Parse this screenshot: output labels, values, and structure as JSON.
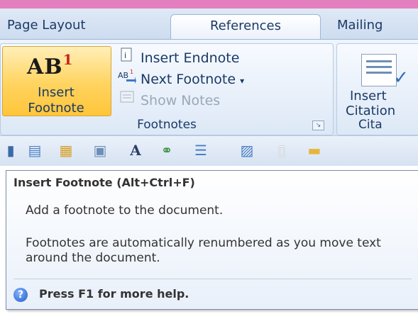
{
  "tabs": {
    "page_layout": "Page Layout",
    "references": "References",
    "mailings": "Mailing"
  },
  "footnotes_group": {
    "insert_footnote_icon": "AB",
    "insert_footnote_sup": "1",
    "insert_footnote_line1": "Insert",
    "insert_footnote_line2": "Footnote",
    "insert_endnote": "Insert Endnote",
    "next_footnote": "Next Footnote",
    "show_notes": "Show Notes",
    "group_label": "Footnotes"
  },
  "citations_group": {
    "insert_line1": "Insert",
    "insert_line2": "Citation",
    "group_label": "Cita"
  },
  "tooltip": {
    "title": "Insert Footnote (Alt+Ctrl+F)",
    "description": "Add a footnote to the document.",
    "details": "Footnotes are automatically renumbered as you move text around the document.",
    "help": "Press F1 for more help."
  },
  "icons": {
    "insert_endnote": "insert-endnote-icon",
    "next_footnote": "next-footnote-icon",
    "show_notes": "show-notes-icon",
    "help": "help-icon"
  }
}
